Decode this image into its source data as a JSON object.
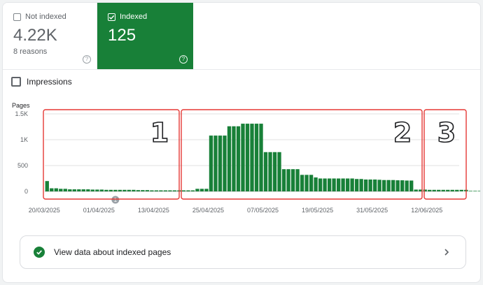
{
  "metrics": {
    "not_indexed": {
      "label": "Not indexed",
      "value": "4.22K",
      "sub": "8 reasons",
      "checked": false
    },
    "indexed": {
      "label": "Indexed",
      "value": "125",
      "checked": true
    }
  },
  "impressions_label": "Impressions",
  "cta_label": "View data about indexed pages",
  "colors": {
    "accent": "#188038",
    "annotation": "#e53935",
    "grid": "#e0e0e0"
  },
  "icons": {
    "help": "help-circle-icon",
    "check": "check-circle-icon",
    "chevron": "chevron-right-icon"
  },
  "chart_data": {
    "type": "bar",
    "ylabel": "Pages",
    "ylim": [
      0,
      1500
    ],
    "yticks": [
      0,
      500,
      1000,
      1500
    ],
    "ytick_labels": [
      "0",
      "500",
      "1K",
      "1.5K"
    ],
    "grid": true,
    "categories": [
      "20/03/2025",
      "21/03/2025",
      "22/03/2025",
      "23/03/2025",
      "24/03/2025",
      "25/03/2025",
      "26/03/2025",
      "27/03/2025",
      "28/03/2025",
      "29/03/2025",
      "30/03/2025",
      "31/03/2025",
      "01/04/2025",
      "02/04/2025",
      "03/04/2025",
      "04/04/2025",
      "05/04/2025",
      "06/04/2025",
      "07/04/2025",
      "08/04/2025",
      "09/04/2025",
      "10/04/2025",
      "11/04/2025",
      "12/04/2025",
      "13/04/2025",
      "14/04/2025",
      "15/04/2025",
      "16/04/2025",
      "17/04/2025",
      "18/04/2025",
      "19/04/2025",
      "20/04/2025",
      "21/04/2025",
      "22/04/2025",
      "23/04/2025",
      "24/04/2025",
      "25/04/2025",
      "26/04/2025",
      "27/04/2025",
      "28/04/2025",
      "29/04/2025",
      "30/04/2025",
      "01/05/2025",
      "02/05/2025",
      "03/05/2025",
      "04/05/2025",
      "05/05/2025",
      "06/05/2025",
      "07/05/2025",
      "08/05/2025",
      "09/05/2025",
      "10/05/2025",
      "11/05/2025",
      "12/05/2025",
      "13/05/2025",
      "14/05/2025",
      "15/05/2025",
      "16/05/2025",
      "17/05/2025",
      "18/05/2025",
      "19/05/2025",
      "20/05/2025",
      "21/05/2025",
      "22/05/2025",
      "23/05/2025",
      "24/05/2025",
      "25/05/2025",
      "26/05/2025",
      "27/05/2025",
      "28/05/2025",
      "29/05/2025",
      "30/05/2025",
      "31/05/2025",
      "01/06/2025",
      "02/06/2025",
      "03/06/2025",
      "04/06/2025",
      "05/06/2025",
      "06/06/2025",
      "07/06/2025",
      "08/06/2025",
      "09/06/2025",
      "10/06/2025",
      "11/06/2025",
      "12/06/2025",
      "13/06/2025",
      "14/06/2025",
      "15/06/2025",
      "16/06/2025",
      "17/06/2025",
      "18/06/2025"
    ],
    "values": [
      200,
      60,
      60,
      50,
      50,
      40,
      40,
      40,
      40,
      40,
      35,
      35,
      35,
      30,
      30,
      30,
      30,
      30,
      30,
      30,
      25,
      25,
      25,
      20,
      20,
      20,
      20,
      20,
      20,
      20,
      20,
      20,
      20,
      50,
      50,
      50,
      1080,
      1080,
      1080,
      1080,
      1260,
      1260,
      1260,
      1310,
      1310,
      1310,
      1310,
      1310,
      760,
      760,
      760,
      760,
      430,
      430,
      430,
      430,
      320,
      320,
      320,
      270,
      250,
      250,
      250,
      250,
      250,
      250,
      250,
      250,
      240,
      240,
      230,
      230,
      230,
      225,
      220,
      220,
      220,
      215,
      215,
      210,
      210,
      35,
      35,
      35,
      30,
      30,
      30,
      30,
      30,
      30,
      30,
      30,
      30,
      10,
      10,
      10,
      30,
      30,
      30,
      30,
      30,
      130,
      130,
      130
    ],
    "x_tick_labels": [
      "20/03/2025",
      "01/04/2025",
      "13/04/2025",
      "25/04/2025",
      "07/05/2025",
      "19/05/2025",
      "31/05/2025",
      "12/06/2025"
    ],
    "annotations": [
      "1",
      "2",
      "3"
    ],
    "event_marker": "1"
  }
}
